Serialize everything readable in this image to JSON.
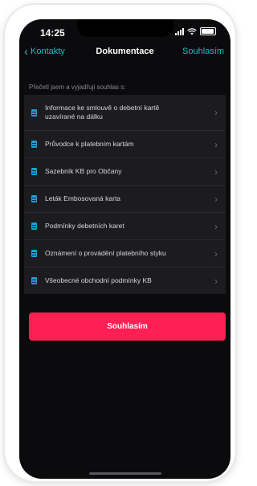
{
  "status_bar": {
    "time": "14:25"
  },
  "nav": {
    "back_label": "Kontakty",
    "title": "Dokumentace",
    "action_label": "Souhlasím"
  },
  "section_header": "Přečetl jsem a vyjadřuji souhlas s:",
  "documents": [
    {
      "lines": [
        "Informace ke smlouvě o debetní kartě",
        "uzavírané na dálku"
      ]
    },
    {
      "lines": [
        "Průvodce k platebním kartám"
      ]
    },
    {
      "lines": [
        "Sazebník KB pro Občany"
      ]
    },
    {
      "lines": [
        "Leták Embosovaná karta"
      ]
    },
    {
      "lines": [
        "Podmínky debetních karet"
      ]
    },
    {
      "lines": [
        "Oznámení o provádění platebního styku"
      ]
    },
    {
      "lines": [
        "Všeobecné obchodní podmínky KB"
      ]
    }
  ],
  "primary_button": {
    "label": "Souhlasím"
  },
  "colors": {
    "accent": "#23b8c5",
    "cta": "#ff1f53",
    "doc_icon": "#1e9ed6",
    "background": "#0b0b0d"
  }
}
